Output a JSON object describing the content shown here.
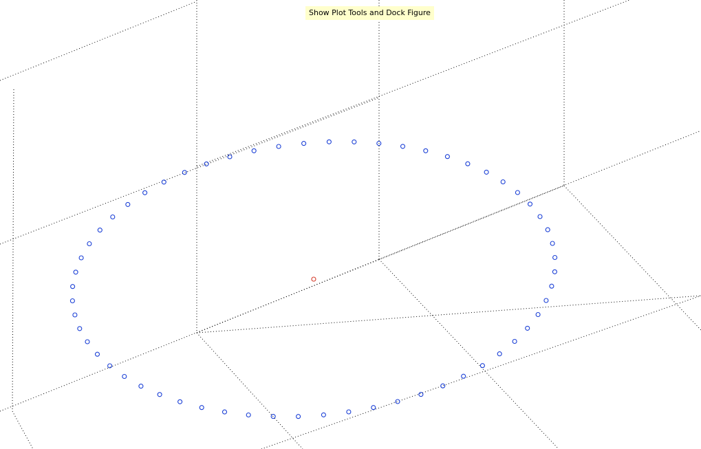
{
  "tooltip": {
    "text": "Show Plot Tools and Dock Figure"
  },
  "colors": {
    "series": "#1a3fd6",
    "highlight": "#d43a2a",
    "grid": "#000000"
  },
  "chart_data": {
    "type": "scatter",
    "view": "3d",
    "title": "",
    "xlabel": "",
    "ylabel": "",
    "zlabel": "",
    "grid": true,
    "marker": "circle",
    "z": 0,
    "series": [
      {
        "angle_deg": [
          0,
          6,
          12,
          18,
          24,
          30,
          36,
          42,
          48,
          54,
          60,
          66,
          72,
          78,
          84,
          90,
          96,
          102,
          108,
          114,
          120,
          126,
          132,
          138,
          144,
          150,
          156,
          162,
          168,
          174,
          180,
          186,
          192,
          198,
          204,
          210,
          216,
          222,
          228,
          234,
          240,
          246,
          252,
          258,
          264,
          270,
          276,
          282,
          288,
          294,
          300,
          306,
          312,
          318,
          324,
          330,
          336,
          342,
          348,
          354
        ],
        "x": [
          1.0,
          0.995,
          0.978,
          0.951,
          0.914,
          0.866,
          0.809,
          0.743,
          0.669,
          0.588,
          0.5,
          0.407,
          0.309,
          0.208,
          0.105,
          0.0,
          -0.105,
          -0.208,
          -0.309,
          -0.407,
          -0.5,
          -0.588,
          -0.669,
          -0.743,
          -0.809,
          -0.866,
          -0.914,
          -0.951,
          -0.978,
          -0.995,
          -1.0,
          -0.995,
          -0.978,
          -0.951,
          -0.914,
          -0.866,
          -0.809,
          -0.743,
          -0.669,
          -0.588,
          -0.5,
          -0.407,
          -0.309,
          -0.208,
          -0.105,
          0.0,
          0.105,
          0.208,
          0.309,
          0.407,
          0.5,
          0.588,
          0.669,
          0.743,
          0.809,
          0.866,
          0.914,
          0.951,
          0.978,
          0.995
        ],
        "y": [
          0.0,
          0.105,
          0.208,
          0.309,
          0.407,
          0.5,
          0.588,
          0.669,
          0.743,
          0.809,
          0.866,
          0.914,
          0.951,
          0.978,
          0.995,
          1.0,
          0.995,
          0.978,
          0.951,
          0.914,
          0.866,
          0.809,
          0.743,
          0.669,
          0.588,
          0.5,
          0.407,
          0.309,
          0.208,
          0.105,
          0.0,
          -0.105,
          -0.208,
          -0.309,
          -0.407,
          -0.5,
          -0.588,
          -0.669,
          -0.743,
          -0.809,
          -0.866,
          -0.914,
          -0.951,
          -0.978,
          -0.995,
          -1.0,
          -0.995,
          -0.978,
          -0.951,
          -0.914,
          -0.866,
          -0.809,
          -0.743,
          -0.669,
          -0.588,
          -0.5,
          -0.407,
          -0.309,
          -0.208,
          -0.105
        ]
      },
      {
        "x": [
          0.0
        ],
        "y": [
          0.0
        ],
        "highlight": true
      }
    ]
  }
}
